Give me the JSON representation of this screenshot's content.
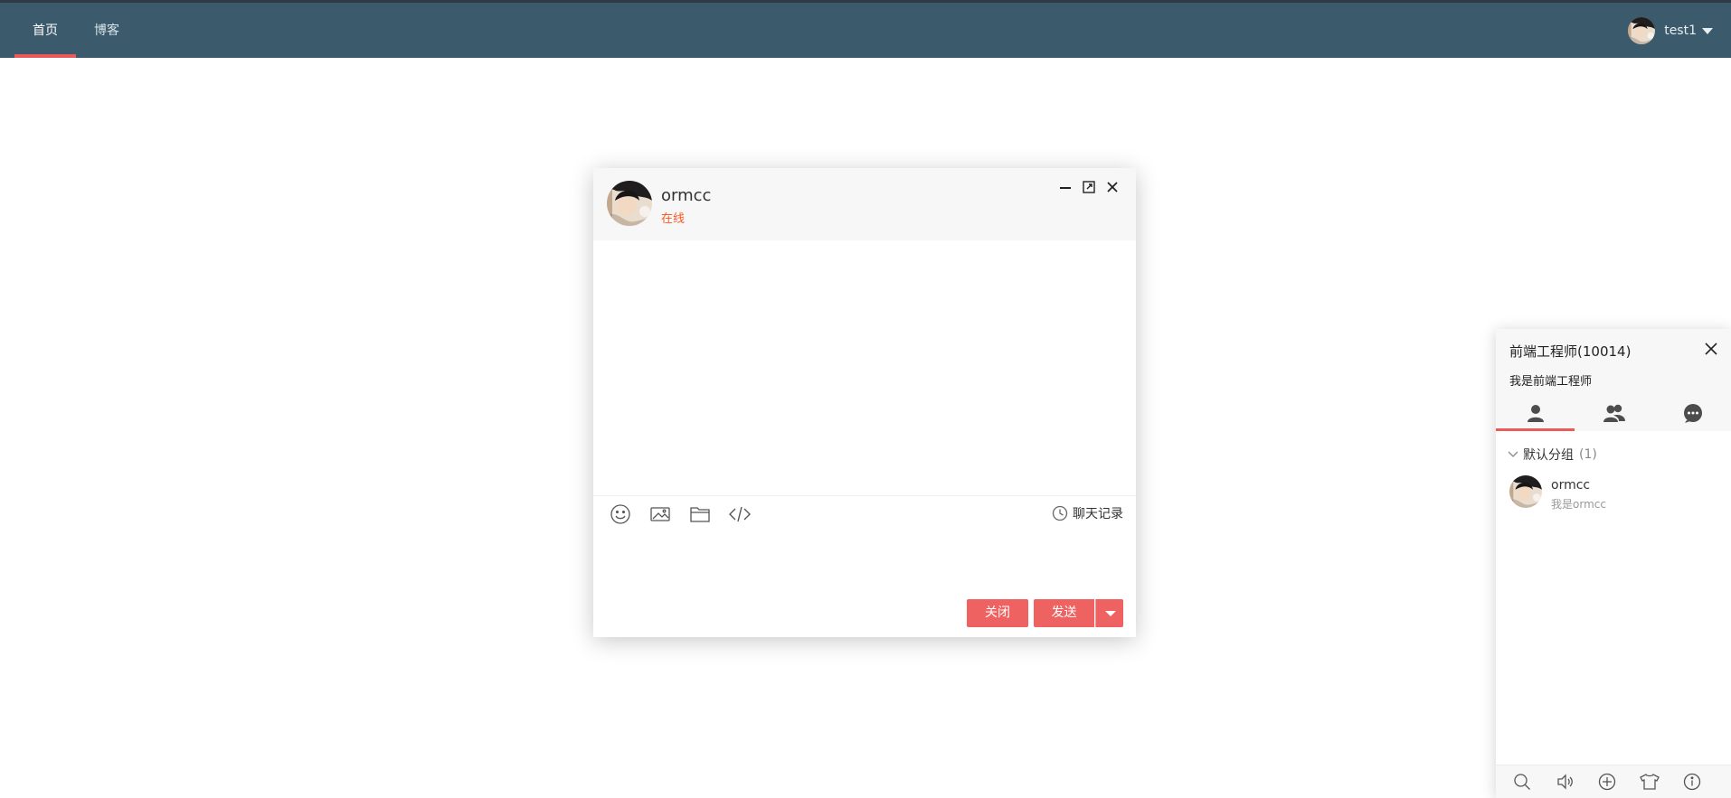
{
  "nav": {
    "items": [
      {
        "label": "首页",
        "active": true
      },
      {
        "label": "博客",
        "active": false
      }
    ],
    "user": {
      "name": "test1"
    }
  },
  "colors": {
    "navbar": "#3b5a6b",
    "accent": "#ea5a5a",
    "button": "#ef6262",
    "status_online": "#ff5722"
  },
  "chat": {
    "contact_name": "ormcc",
    "contact_status": "在线",
    "window_controls": [
      "minimize-icon",
      "maximize-icon",
      "close-icon"
    ],
    "toolbar_icons": [
      "emoji-icon",
      "image-icon",
      "folder-icon",
      "code-icon"
    ],
    "history_label": "聊天记录",
    "input_value": "",
    "close_label": "关闭",
    "send_label": "发送"
  },
  "panel": {
    "title": "前端工程师(10014)",
    "signature": "我是前端工程师",
    "tabs": [
      "friend-icon",
      "group-icon",
      "history-chat-icon"
    ],
    "group": {
      "name": "默认分组",
      "count": "(1)"
    },
    "friends": [
      {
        "name": "ormcc",
        "sign": "我是ormcc"
      }
    ],
    "footer_icons": [
      "search-icon",
      "volume-icon",
      "add-icon",
      "skin-icon",
      "about-icon"
    ]
  }
}
